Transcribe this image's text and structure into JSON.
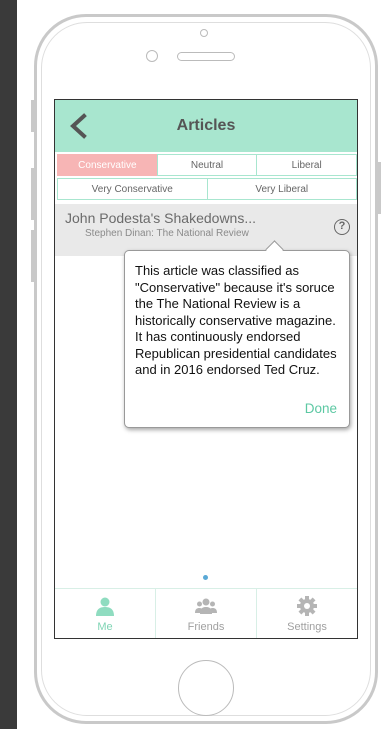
{
  "nav": {
    "title": "Articles",
    "back_icon": "chevron-left-icon"
  },
  "filters": {
    "row1": [
      {
        "label": "Conservative",
        "active": true
      },
      {
        "label": "Neutral",
        "active": false
      },
      {
        "label": "Liberal",
        "active": false
      }
    ],
    "row2": [
      {
        "label": "Very Conservative",
        "active": false
      },
      {
        "label": "Very Liberal",
        "active": false
      }
    ]
  },
  "article": {
    "title": "John Podesta's Shakedowns...",
    "byline": "Stephen Dinan: The National Review",
    "help_icon_text": "?"
  },
  "popover": {
    "text": "This article was classified as \"Conservative\" because it's soruce the The National Review is a historically conservative magazine. It has continuously endorsed Republican presidential candidates and in 2016 endorsed Ted Cruz.",
    "done_label": "Done"
  },
  "tabs": [
    {
      "label": "Me",
      "icon": "person-icon",
      "active": true
    },
    {
      "label": "Friends",
      "icon": "group-icon",
      "active": false
    },
    {
      "label": "Settings",
      "icon": "gear-icon",
      "active": false
    }
  ],
  "colors": {
    "accent": "#a8e6cf",
    "active_filter": "#f7b5b5",
    "done": "#5cc8a3",
    "active_tab": "#7fd4b4"
  }
}
